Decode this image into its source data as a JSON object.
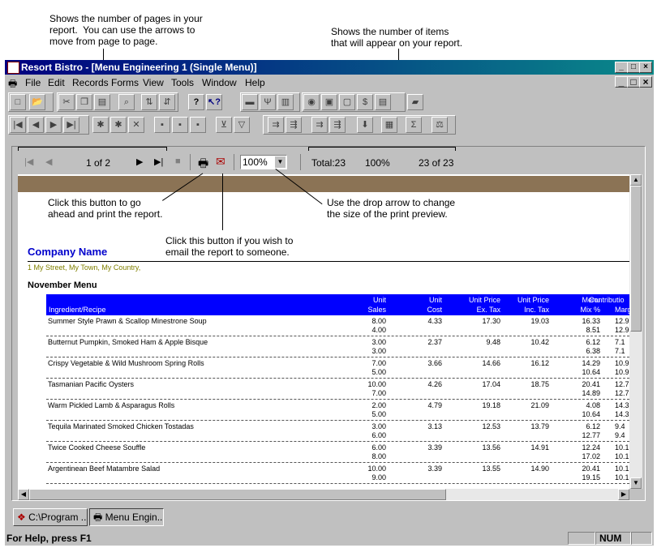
{
  "annotations": {
    "pages_note": "Shows the number of pages in your\nreport.  You can use the arrows to\nmove from page to page.",
    "items_note": "Shows the number of items\nthat will appear on your report.",
    "print_note": "Click this button to go\nahead and print the report.",
    "email_note": "Click this button if you wish to\nemail the report to someone.",
    "zoom_note": "Use the drop arrow to change\nthe size of the print preview."
  },
  "window": {
    "title": "Resort Bistro - [Menu Engineering 1 (Single Menu)]"
  },
  "menu": [
    "File",
    "Edit",
    "Records",
    "Forms",
    "View",
    "Tools",
    "Window",
    "Help"
  ],
  "preview": {
    "page_indicator": "1 of 2",
    "zoom": "100%",
    "total": "Total:23",
    "percent": "100%",
    "item_count": "23 of 23"
  },
  "report": {
    "company": "Company Name",
    "address": "1 My Street, My Town, My Country,",
    "section": "November Menu",
    "headers": [
      {
        "top": "",
        "bottom": "Ingredient/Recipe"
      },
      {
        "top": "Unit",
        "bottom": "Sales"
      },
      {
        "top": "Unit",
        "bottom": "Cost"
      },
      {
        "top": "Unit Price",
        "bottom": "Ex. Tax"
      },
      {
        "top": "Unit Price",
        "bottom": "Inc. Tax"
      },
      {
        "top": "Menu",
        "bottom": "Mix %"
      },
      {
        "top": "Contributio",
        "bottom": "Margi"
      }
    ],
    "rows": [
      {
        "name": "Summer Style Prawn & Scallop Minestrone Soup",
        "sales": "8.00",
        "cost": "4.33",
        "ex": "17.30",
        "inc": "19.03",
        "mix": "16.33",
        "margin": "12.9",
        "sales2": "4.00",
        "mix2": "8.51",
        "margin2": "12.9"
      },
      {
        "name": "Butternut Pumpkin, Smoked Ham & Apple Bisque",
        "sales": "3.00",
        "cost": "2.37",
        "ex": "9.48",
        "inc": "10.42",
        "mix": "6.12",
        "margin": "7.1",
        "sales2": "3.00",
        "mix2": "6.38",
        "margin2": "7.1"
      },
      {
        "name": "Crispy Vegetable & Wild Mushroom Spring Rolls",
        "sales": "7.00",
        "cost": "3.66",
        "ex": "14.66",
        "inc": "16.12",
        "mix": "14.29",
        "margin": "10.9",
        "sales2": "5.00",
        "mix2": "10.64",
        "margin2": "10.9"
      },
      {
        "name": "Tasmanian Pacific Oysters",
        "sales": "10.00",
        "cost": "4.26",
        "ex": "17.04",
        "inc": "18.75",
        "mix": "20.41",
        "margin": "12.7",
        "sales2": "7.00",
        "mix2": "14.89",
        "margin2": "12.7"
      },
      {
        "name": "Warm Pickled Lamb & Asparagus Rolls",
        "sales": "2.00",
        "cost": "4.79",
        "ex": "19.18",
        "inc": "21.09",
        "mix": "4.08",
        "margin": "14.3",
        "sales2": "5.00",
        "mix2": "10.64",
        "margin2": "14.3"
      },
      {
        "name": "Tequila Marinated Smoked Chicken Tostadas",
        "sales": "3.00",
        "cost": "3.13",
        "ex": "12.53",
        "inc": "13.79",
        "mix": "6.12",
        "margin": "9.4",
        "sales2": "6.00",
        "mix2": "12.77",
        "margin2": "9.4"
      },
      {
        "name": "Twice Cooked Cheese Souffle",
        "sales": "6.00",
        "cost": "3.39",
        "ex": "13.56",
        "inc": "14.91",
        "mix": "12.24",
        "margin": "10.1",
        "sales2": "8.00",
        "mix2": "17.02",
        "margin2": "10.1"
      },
      {
        "name": "Argentinean Beef Matambre Salad",
        "sales": "10.00",
        "cost": "3.39",
        "ex": "13.55",
        "inc": "14.90",
        "mix": "20.41",
        "margin": "10.1",
        "sales2": "9.00",
        "mix2": "19.15",
        "margin2": "10.1"
      }
    ]
  },
  "taskbar": {
    "item1": "C:\\Program ...",
    "item2": "Menu Engin..."
  },
  "status": {
    "help": "For Help, press F1",
    "num": "NUM"
  }
}
